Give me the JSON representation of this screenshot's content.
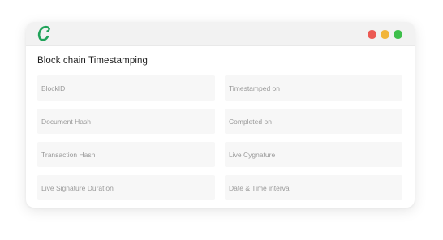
{
  "titlebar": {
    "logo_icon": "c-logo-icon",
    "logo_color": "#21a35a",
    "window_controls": [
      {
        "name": "close-control",
        "color": "#ec5a54"
      },
      {
        "name": "minimize-control",
        "color": "#f2b53a"
      },
      {
        "name": "maximize-control",
        "color": "#3ebf4b"
      }
    ]
  },
  "main": {
    "heading": "Block chain Timestamping",
    "fields": [
      {
        "placeholder": "BlockID"
      },
      {
        "placeholder": "Timestamped on"
      },
      {
        "placeholder": "Document Hash"
      },
      {
        "placeholder": "Completed on"
      },
      {
        "placeholder": "Transaction Hash"
      },
      {
        "placeholder": "Live Cygnature"
      },
      {
        "placeholder": "Live Signature Duration"
      },
      {
        "placeholder": "Date & Time interval"
      }
    ]
  }
}
